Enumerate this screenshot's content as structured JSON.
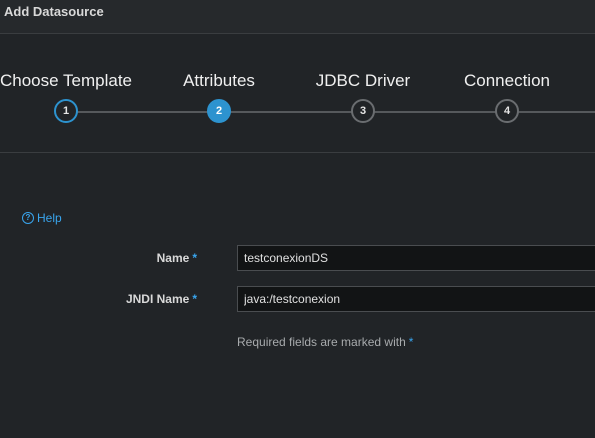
{
  "dialog": {
    "title": "Add Datasource"
  },
  "wizard": {
    "steps": [
      {
        "label": "Choose Template",
        "number": "1",
        "state": "completed"
      },
      {
        "label": "Attributes",
        "number": "2",
        "state": "active"
      },
      {
        "label": "JDBC Driver",
        "number": "3",
        "state": "pending"
      },
      {
        "label": "Connection",
        "number": "4",
        "state": "pending"
      }
    ]
  },
  "help": {
    "label": "Help",
    "icon": "question-circle-icon"
  },
  "form": {
    "required_marker": "*",
    "fields": [
      {
        "label": "Name",
        "value": "testconexionDS"
      },
      {
        "label": "JNDI Name",
        "value": "java:/testconexion"
      }
    ],
    "required_note": "Required fields are marked with"
  },
  "colors": {
    "accent": "#2d93cf",
    "link": "#39a5ee",
    "background": "#212427"
  }
}
